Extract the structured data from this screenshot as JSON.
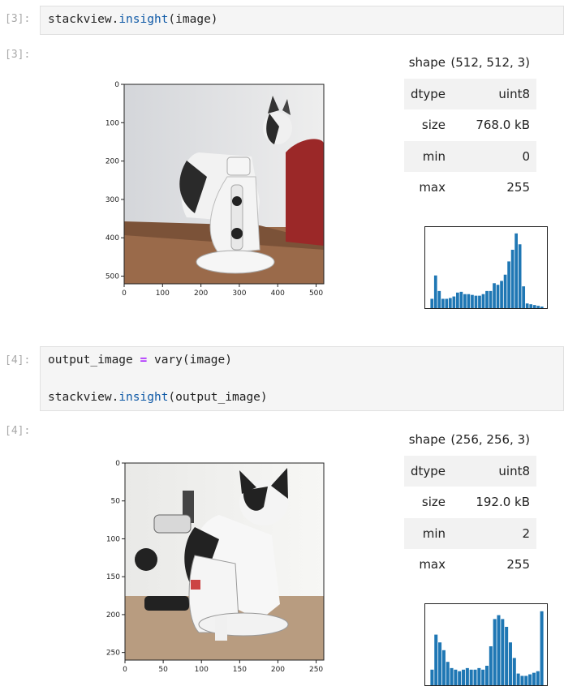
{
  "cells": [
    {
      "input_prompt": "[3]:",
      "output_prompt": "[3]:",
      "code": {
        "line1_obj": "stackview.",
        "line1_fn": "insight",
        "line1_args": "(image)"
      },
      "stats": [
        {
          "key": "shape",
          "value": "(512, 512, 3)"
        },
        {
          "key": "dtype",
          "value": "uint8"
        },
        {
          "key": "size",
          "value": "768.0 kB"
        },
        {
          "key": "min",
          "value": "0"
        },
        {
          "key": "max",
          "value": "255"
        }
      ],
      "axis": {
        "x_ticks": [
          "0",
          "100",
          "200",
          "300",
          "400",
          "500"
        ],
        "y_ticks": [
          "0",
          "100",
          "200",
          "300",
          "400",
          "500"
        ]
      },
      "histogram": [
        0.12,
        0.42,
        0.22,
        0.12,
        0.12,
        0.13,
        0.15,
        0.2,
        0.21,
        0.18,
        0.18,
        0.17,
        0.16,
        0.16,
        0.18,
        0.22,
        0.22,
        0.32,
        0.3,
        0.35,
        0.43,
        0.6,
        0.75,
        0.96,
        0.82,
        0.28,
        0.06,
        0.05,
        0.04,
        0.03,
        0.02
      ]
    },
    {
      "input_prompt": "[4]:",
      "output_prompt": "[4]:",
      "code": {
        "line1_var": "output_image",
        "line1_op": "=",
        "line1_rest": "vary(image)",
        "line2_obj": "stackview.",
        "line2_fn": "insight",
        "line2_args": "(output_image)"
      },
      "stats": [
        {
          "key": "shape",
          "value": "(256, 256, 3)"
        },
        {
          "key": "dtype",
          "value": "uint8"
        },
        {
          "key": "size",
          "value": "192.0 kB"
        },
        {
          "key": "min",
          "value": "2"
        },
        {
          "key": "max",
          "value": "255"
        }
      ],
      "axis": {
        "x_ticks": [
          "0",
          "50",
          "100",
          "150",
          "200",
          "250"
        ],
        "y_ticks": [
          "0",
          "50",
          "100",
          "150",
          "200",
          "250"
        ]
      },
      "histogram": [
        0.2,
        0.65,
        0.55,
        0.45,
        0.3,
        0.22,
        0.2,
        0.18,
        0.2,
        0.22,
        0.2,
        0.2,
        0.22,
        0.2,
        0.25,
        0.5,
        0.85,
        0.9,
        0.85,
        0.75,
        0.55,
        0.35,
        0.15,
        0.12,
        0.12,
        0.14,
        0.16,
        0.18,
        0.95
      ]
    }
  ]
}
